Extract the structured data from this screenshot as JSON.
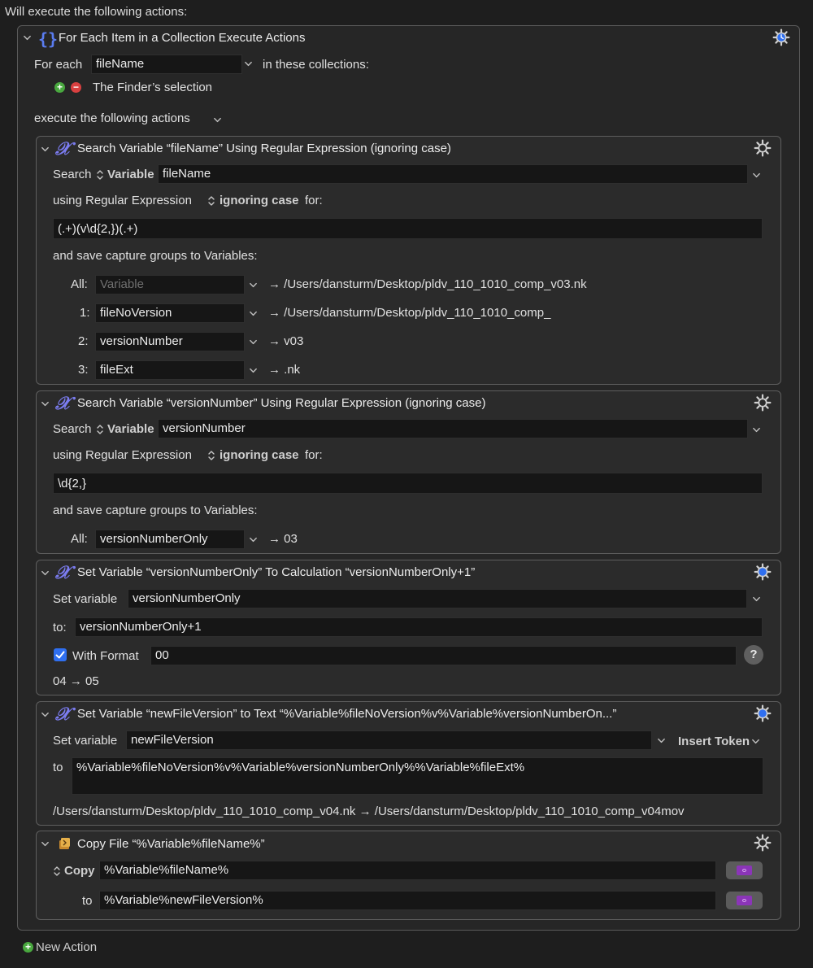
{
  "heading": "Will execute the following actions:",
  "foreach": {
    "title": "For Each Item in a Collection Execute Actions",
    "for_each_label": "For each",
    "variable": "fileName",
    "in_collections_label": "in these collections:",
    "collection_item": "The Finder’s selection",
    "execute_label": "execute the following actions"
  },
  "action1": {
    "title": "Search Variable “fileName” Using Regular Expression (ignoring case)",
    "search_label": "Search",
    "variable_label": "Variable",
    "variable_value": "fileName",
    "using_label": "using Regular Expression",
    "ignoring_label": "ignoring case",
    "for_label": "for:",
    "regex": "(.+)(v\\d{2,})(.+)",
    "save_label": "and save capture groups to Variables:",
    "groups": [
      {
        "label": "All:",
        "value": "",
        "placeholder": "Variable",
        "result": "→ /Users/dansturm/Desktop/pldv_110_1010_comp_v03.nk"
      },
      {
        "label": "1:",
        "value": "fileNoVersion",
        "placeholder": "",
        "result": "→ /Users/dansturm/Desktop/pldv_110_1010_comp_"
      },
      {
        "label": "2:",
        "value": "versionNumber",
        "placeholder": "",
        "result": "→ v03"
      },
      {
        "label": "3:",
        "value": "fileExt",
        "placeholder": "",
        "result": "→ .nk"
      }
    ]
  },
  "action2": {
    "title": "Search Variable “versionNumber” Using Regular Expression (ignoring case)",
    "search_label": "Search",
    "variable_label": "Variable",
    "variable_value": "versionNumber",
    "using_label": "using Regular Expression",
    "ignoring_label": "ignoring case",
    "for_label": "for:",
    "regex": "\\d{2,}",
    "save_label": "and save capture groups to Variables:",
    "group_label": "All:",
    "group_value": "versionNumberOnly",
    "group_result": "→ 03"
  },
  "action3": {
    "title": "Set Variable “versionNumberOnly” To Calculation “versionNumberOnly+1”",
    "set_label": "Set variable",
    "variable_value": "versionNumberOnly",
    "to_label": "to:",
    "calc": "versionNumberOnly+1",
    "with_format_label": "With Format",
    "format_value": "00",
    "help": "?",
    "result": "04 → 05"
  },
  "action4": {
    "title": "Set Variable “newFileVersion” to Text “%Variable%fileNoVersion%v%Variable%versionNumberOn...”",
    "set_label": "Set variable",
    "variable_value": "newFileVersion",
    "insert_token": "Insert Token",
    "to_label": "to",
    "text": "%Variable%fileNoVersion%v%Variable%versionNumberOnly%%Variable%fileExt%",
    "result": "/Users/dansturm/Desktop/pldv_110_1010_comp_v04.nk → /Users/dansturm/Desktop/pldv_110_1010_comp_v04mov"
  },
  "action5": {
    "title": "Copy File “%Variable%fileName%”",
    "copy_label": "Copy",
    "source": "%Variable%fileName%",
    "to_label": "to",
    "dest": "%Variable%newFileVersion%"
  },
  "new_action": "New Action",
  "colors": {
    "background": "#1e1e1e",
    "accent_blue": "#2f6ff0",
    "plus_green": "#49a83f",
    "minus_red": "#d94040",
    "variable_purple": "#7b7cf0"
  }
}
